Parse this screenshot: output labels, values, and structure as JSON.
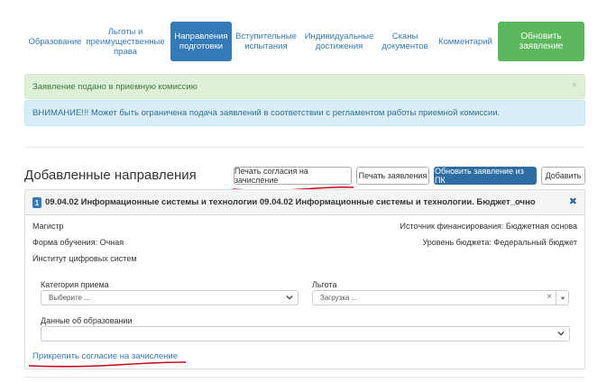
{
  "nav": {
    "tabs": [
      {
        "label": "Образование"
      },
      {
        "label": "Льготы и преимущественные права"
      },
      {
        "label": "Направления подготовки"
      },
      {
        "label": "Вступительные испытания"
      },
      {
        "label": "Индивидуальные достижения"
      },
      {
        "label": "Сканы документов"
      },
      {
        "label": "Комментарий"
      }
    ],
    "update_button": "Обновить заявление"
  },
  "alerts": {
    "success": "Заявление подано в приемную комиссию",
    "success_close": "×",
    "info": "ВНИМАНИЕ!!! Может быть ограничена подача заявлений в соответствии с регламентом работы приемной комиссии."
  },
  "section": {
    "title": "Добавленные направления",
    "buttons": {
      "print_consent": "Печать согласия на зачисление",
      "print_application": "Печать заявления",
      "update_from_pk": "Обновить заявление из ПК",
      "add": "Добавить"
    }
  },
  "direction": {
    "number": "1",
    "title": "09.04.02 Информационные системы и технологии 09.04.02 Информационные системы и технологии. Бюджет_очно",
    "close": "✖",
    "degree": "Магистр",
    "study_form": "Форма обучения: Очная",
    "institute": "Институт цифровых систем",
    "funding_source": "Источник финансирования: Бюджетная основа",
    "budget_level": "Уровень бюджета: Федеральный бюджет",
    "fields": {
      "category_label": "Категория приема",
      "category_value": "Выберите ...",
      "benefit_label": "Льгота",
      "benefit_value": "Загрузка ...",
      "benefit_clear": "×",
      "education_label": "Данные об образовании",
      "education_value": ""
    },
    "attach_consent": "Прикрепить согласие на зачисление"
  },
  "colors": {
    "primary": "#337ab7",
    "success_btn": "#5cb85c",
    "annotation": "#d0021b"
  }
}
